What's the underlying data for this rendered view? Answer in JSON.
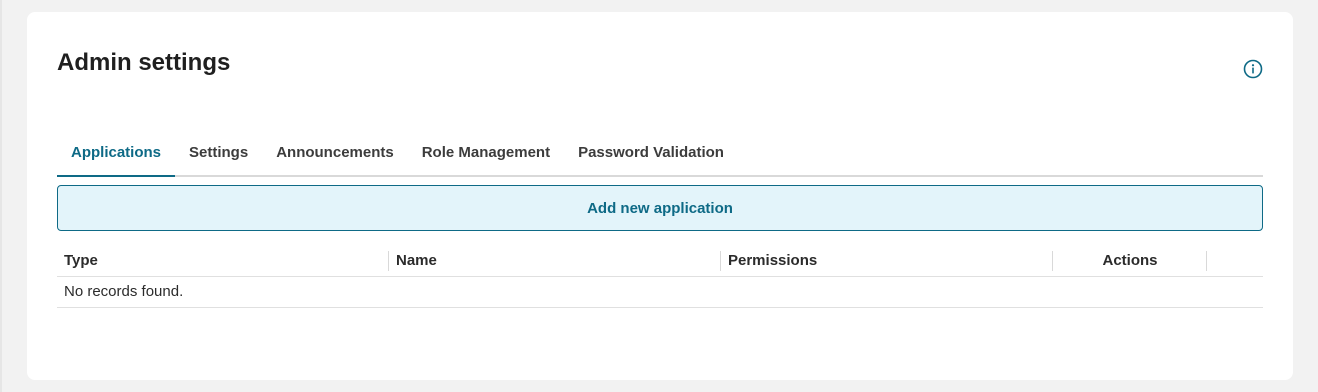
{
  "page": {
    "title": "Admin settings"
  },
  "icons": {
    "info": "info-circle-icon"
  },
  "tabs": [
    {
      "label": "Applications",
      "active": true
    },
    {
      "label": "Settings",
      "active": false
    },
    {
      "label": "Announcements",
      "active": false
    },
    {
      "label": "Role Management",
      "active": false
    },
    {
      "label": "Password Validation",
      "active": false
    }
  ],
  "add_button": {
    "label": "Add new application"
  },
  "table": {
    "columns": [
      "Type",
      "Name",
      "Permissions",
      "Actions"
    ],
    "empty_message": "No records found."
  },
  "colors": {
    "accent": "#0e6a86",
    "button_bg": "#e3f4fa",
    "page_bg": "#f2f2f2",
    "card_bg": "#ffffff"
  }
}
